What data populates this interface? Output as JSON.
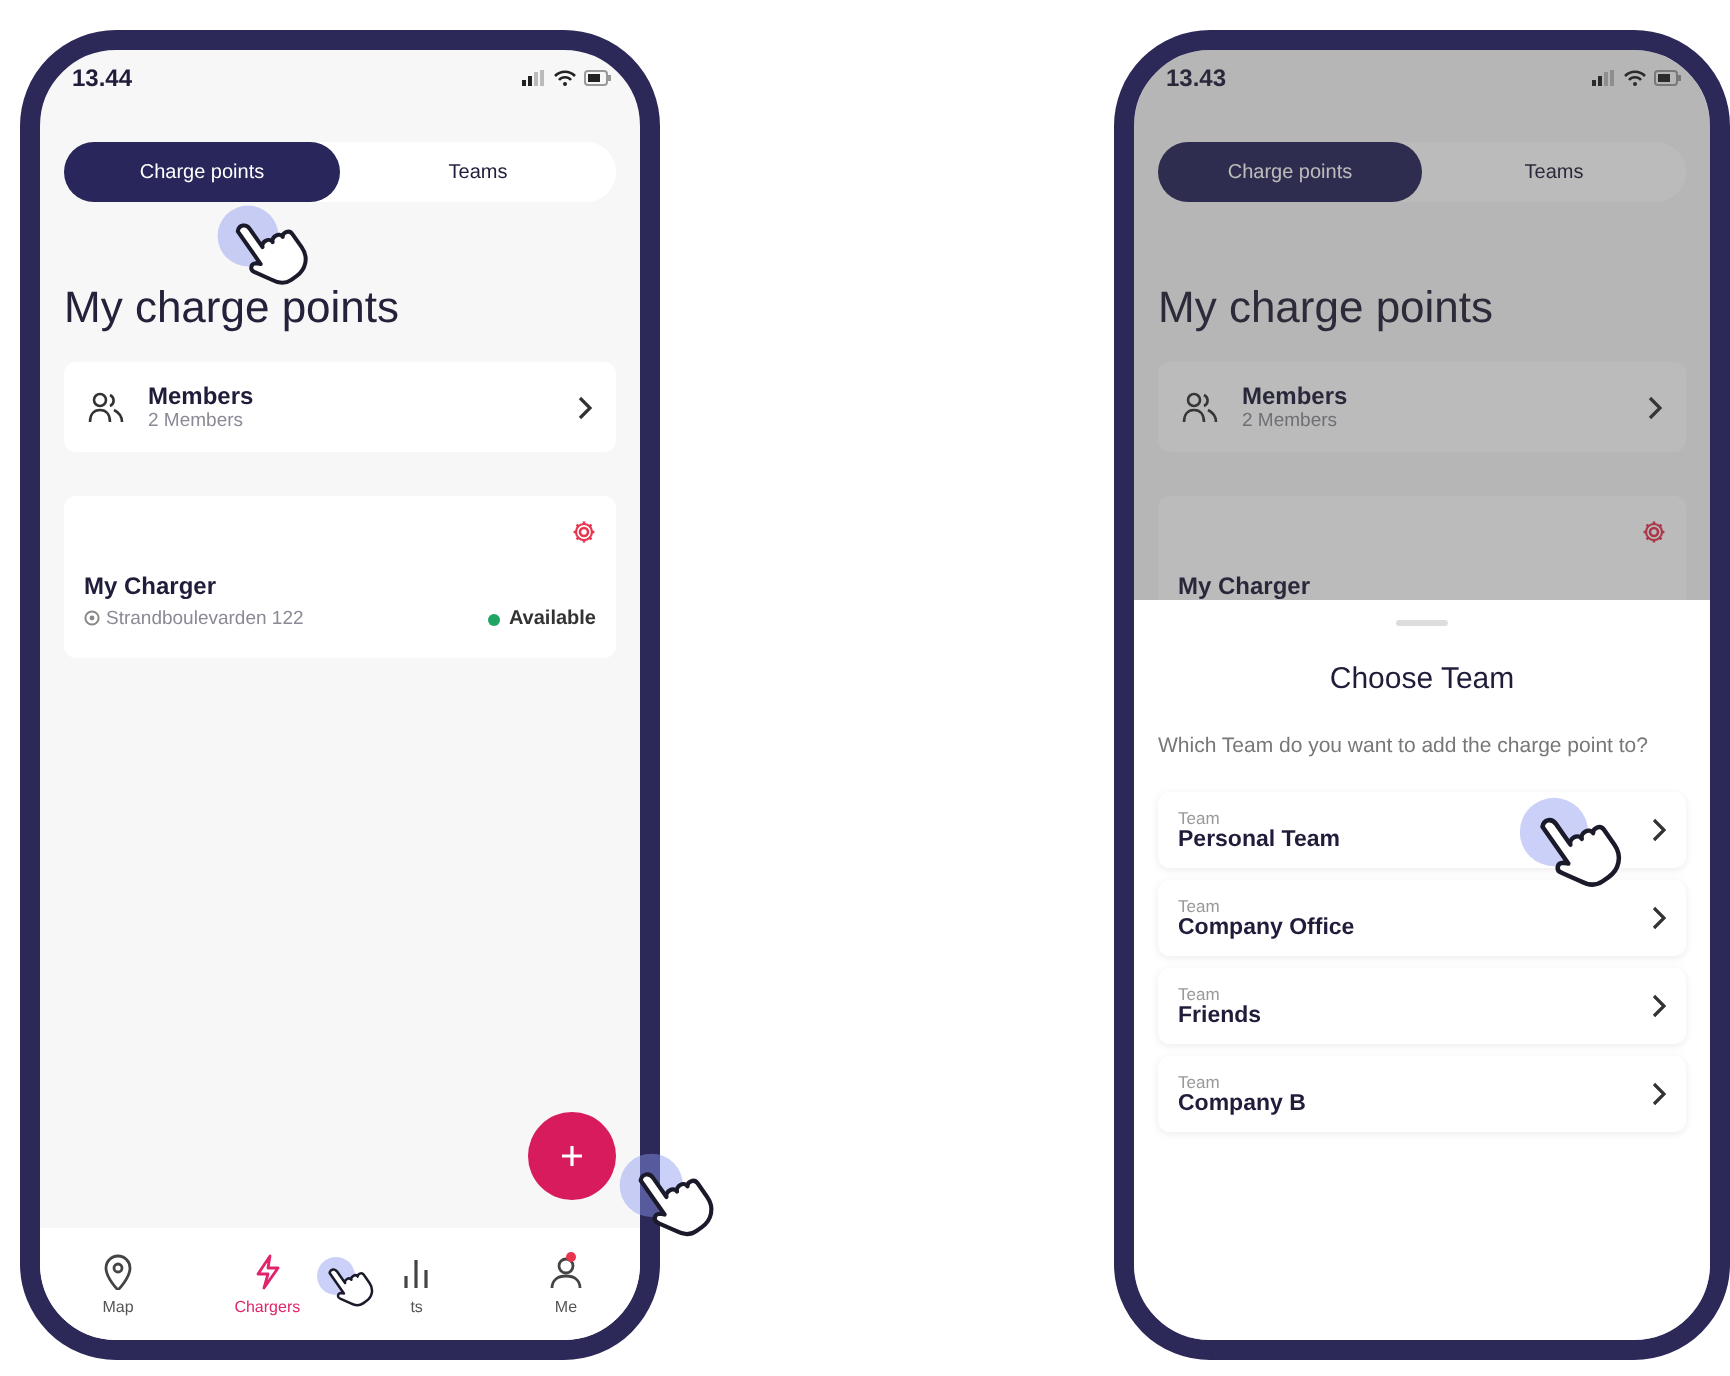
{
  "phones": [
    {
      "status_bar": {
        "time": "13.44"
      },
      "dimmed": false,
      "tabs": [
        {
          "label": "Charge points",
          "selected": true,
          "tapped": true
        },
        {
          "label": "Teams",
          "selected": false,
          "tapped": false
        }
      ],
      "title": "My charge points",
      "members": {
        "title": "Members",
        "subtitle": "2 Members"
      },
      "charger": {
        "name": "My Charger",
        "address": "Strandboulevarden 122",
        "status": "Available",
        "color": "#1fa463"
      },
      "fab": {
        "tapped": true
      },
      "nav": [
        {
          "kind": "map",
          "label": "Map",
          "selected": false,
          "tapped": false,
          "badge": false
        },
        {
          "kind": "chargers",
          "label": "Chargers",
          "selected": true,
          "tapped": true,
          "badge": false
        },
        {
          "kind": "stats",
          "label": "ts",
          "selected": false,
          "tapped": false,
          "badge": false
        },
        {
          "kind": "me",
          "label": "Me",
          "selected": false,
          "tapped": false,
          "badge": true
        }
      ]
    },
    {
      "status_bar": {
        "time": "13.43"
      },
      "dimmed": true,
      "tabs": [
        {
          "label": "Charge points",
          "selected": true,
          "tapped": false
        },
        {
          "label": "Teams",
          "selected": false,
          "tapped": false
        }
      ],
      "title": "My charge points",
      "members": {
        "title": "Members",
        "subtitle": "2 Members"
      },
      "charger": {
        "name": "My Charger"
      },
      "sheet": {
        "title": "Choose Team",
        "description": "Which Team do you want to add the charge point to?",
        "teams": [
          {
            "label": "Team",
            "name": "Personal Team",
            "tapped": true
          },
          {
            "label": "Team",
            "name": "Company Office",
            "tapped": false
          },
          {
            "label": "Team",
            "name": "Friends",
            "tapped": false
          },
          {
            "label": "Team",
            "name": "Company B",
            "tapped": false
          }
        ]
      }
    }
  ]
}
